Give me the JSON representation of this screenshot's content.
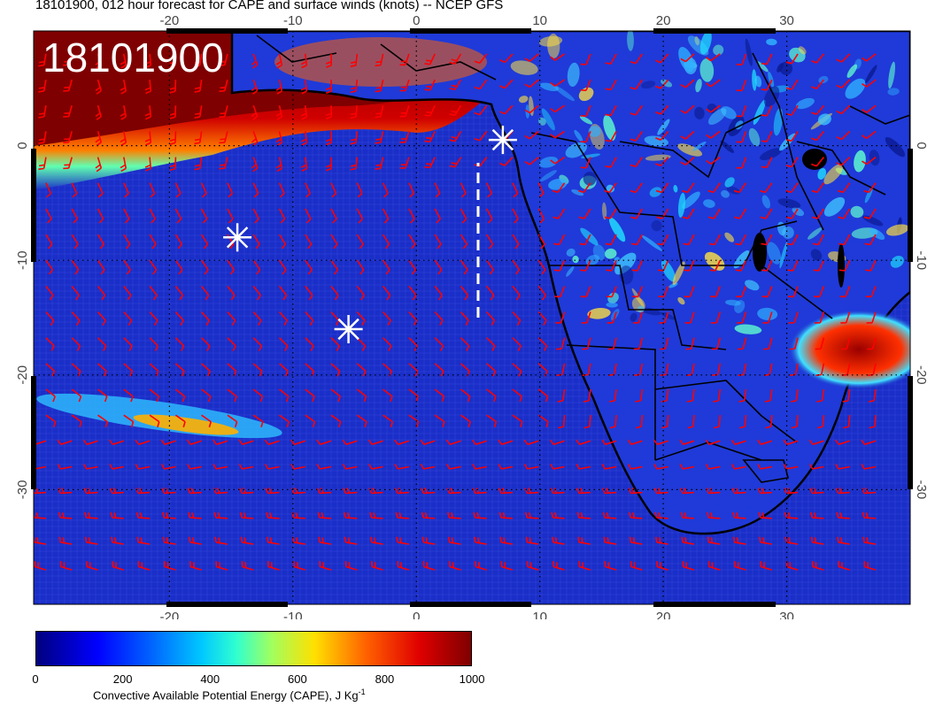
{
  "title": "18101900, 012 hour forecast for CAPE and surface winds (knots) -- NCEP GFS",
  "stamp": "18101900",
  "map": {
    "lon_range": [
      -31,
      40
    ],
    "lat_range": [
      -40,
      10
    ],
    "lon_ticks": [
      "-20",
      "-10",
      "0",
      "10",
      "20",
      "30"
    ],
    "lat_ticks": [
      "0",
      "-10",
      "-20",
      "-30"
    ],
    "markers": [
      {
        "lon": 7,
        "lat": 0.5
      },
      {
        "lon": -14.5,
        "lat": -8
      },
      {
        "lon": -5.5,
        "lat": -16
      }
    ],
    "dashed_line_lon": 5,
    "dashed_line_lat": [
      -15,
      -1.5
    ],
    "colors": {
      "ocean": "#1a2ec8",
      "land": "#1b34d9",
      "high_cape": "#7f0000",
      "barb": "#ff0000",
      "coast": "#000000"
    }
  },
  "colorbar": {
    "ticks": [
      "0",
      "200",
      "400",
      "600",
      "800",
      "1000"
    ],
    "label_main": "Convective Available Potential Energy (CAPE), J Kg",
    "label_sup": "-1"
  }
}
